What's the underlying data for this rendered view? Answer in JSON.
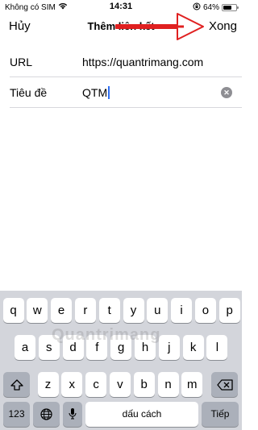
{
  "status_bar": {
    "carrier": "Không có SIM",
    "time": "14:31",
    "battery": "64%",
    "battery_level": 0.64
  },
  "nav": {
    "cancel_label": "Hủy",
    "title": "Thêm liên kết",
    "done_label": "Xong"
  },
  "form": {
    "url_label": "URL",
    "url_value": "https://quantrimang.com",
    "title_label": "Tiêu đề",
    "title_value": "QTM"
  },
  "keyboard": {
    "row1": [
      "q",
      "w",
      "e",
      "r",
      "t",
      "y",
      "u",
      "i",
      "o",
      "p"
    ],
    "row2": [
      "a",
      "s",
      "d",
      "f",
      "g",
      "h",
      "j",
      "k",
      "l"
    ],
    "row3": [
      "z",
      "x",
      "c",
      "v",
      "b",
      "n",
      "m"
    ],
    "numbers_label": "123",
    "space_label": "dấu cách",
    "return_label": "Tiếp"
  },
  "watermark": "Quantrimang",
  "colors": {
    "caret": "#2f6ff2",
    "annotation_arrow": "#e02020",
    "keyboard_bg": "#d3d5db"
  }
}
